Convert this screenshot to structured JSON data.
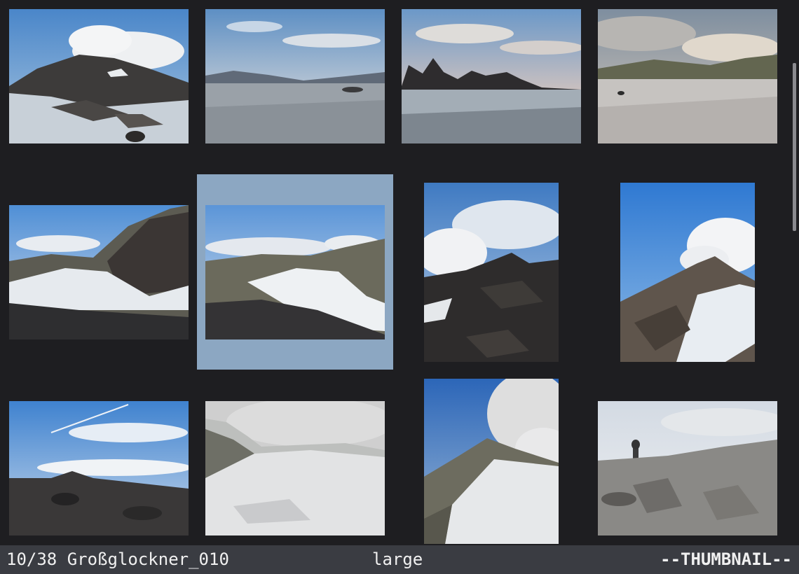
{
  "statusbar": {
    "index": "10/38",
    "filename": "Großglockner_010",
    "thumbnail_size": "large",
    "mode": "--THUMBNAIL--"
  },
  "thumbnails": [
    {
      "name": "thumb-01",
      "scene": "rocky peak with cloud and snow"
    },
    {
      "name": "thumb-02",
      "scene": "glacier plain at dawn"
    },
    {
      "name": "thumb-03",
      "scene": "jagged ridge above glacier"
    },
    {
      "name": "thumb-04",
      "scene": "cloudy glacier plateau"
    },
    {
      "name": "thumb-05",
      "scene": "snowy slope with dark ridge"
    },
    {
      "name": "thumb-06",
      "scene": "valley glacier under thin clouds"
    },
    {
      "name": "thumb-07",
      "scene": "dark rocky summit with clouds"
    },
    {
      "name": "thumb-08",
      "scene": "peak with cloud cap"
    },
    {
      "name": "thumb-09",
      "scene": "sky above rocky ridge"
    },
    {
      "name": "thumb-10",
      "scene": "foggy snowfield"
    },
    {
      "name": "thumb-11",
      "scene": "snowy slope into fog"
    },
    {
      "name": "thumb-12",
      "scene": "boulder field with cairn"
    }
  ],
  "colors": {
    "background": "#1e1e21",
    "selection": "#8ca7c2",
    "statusbar": "#3a3c42",
    "status_text": "#f0f0f0"
  }
}
